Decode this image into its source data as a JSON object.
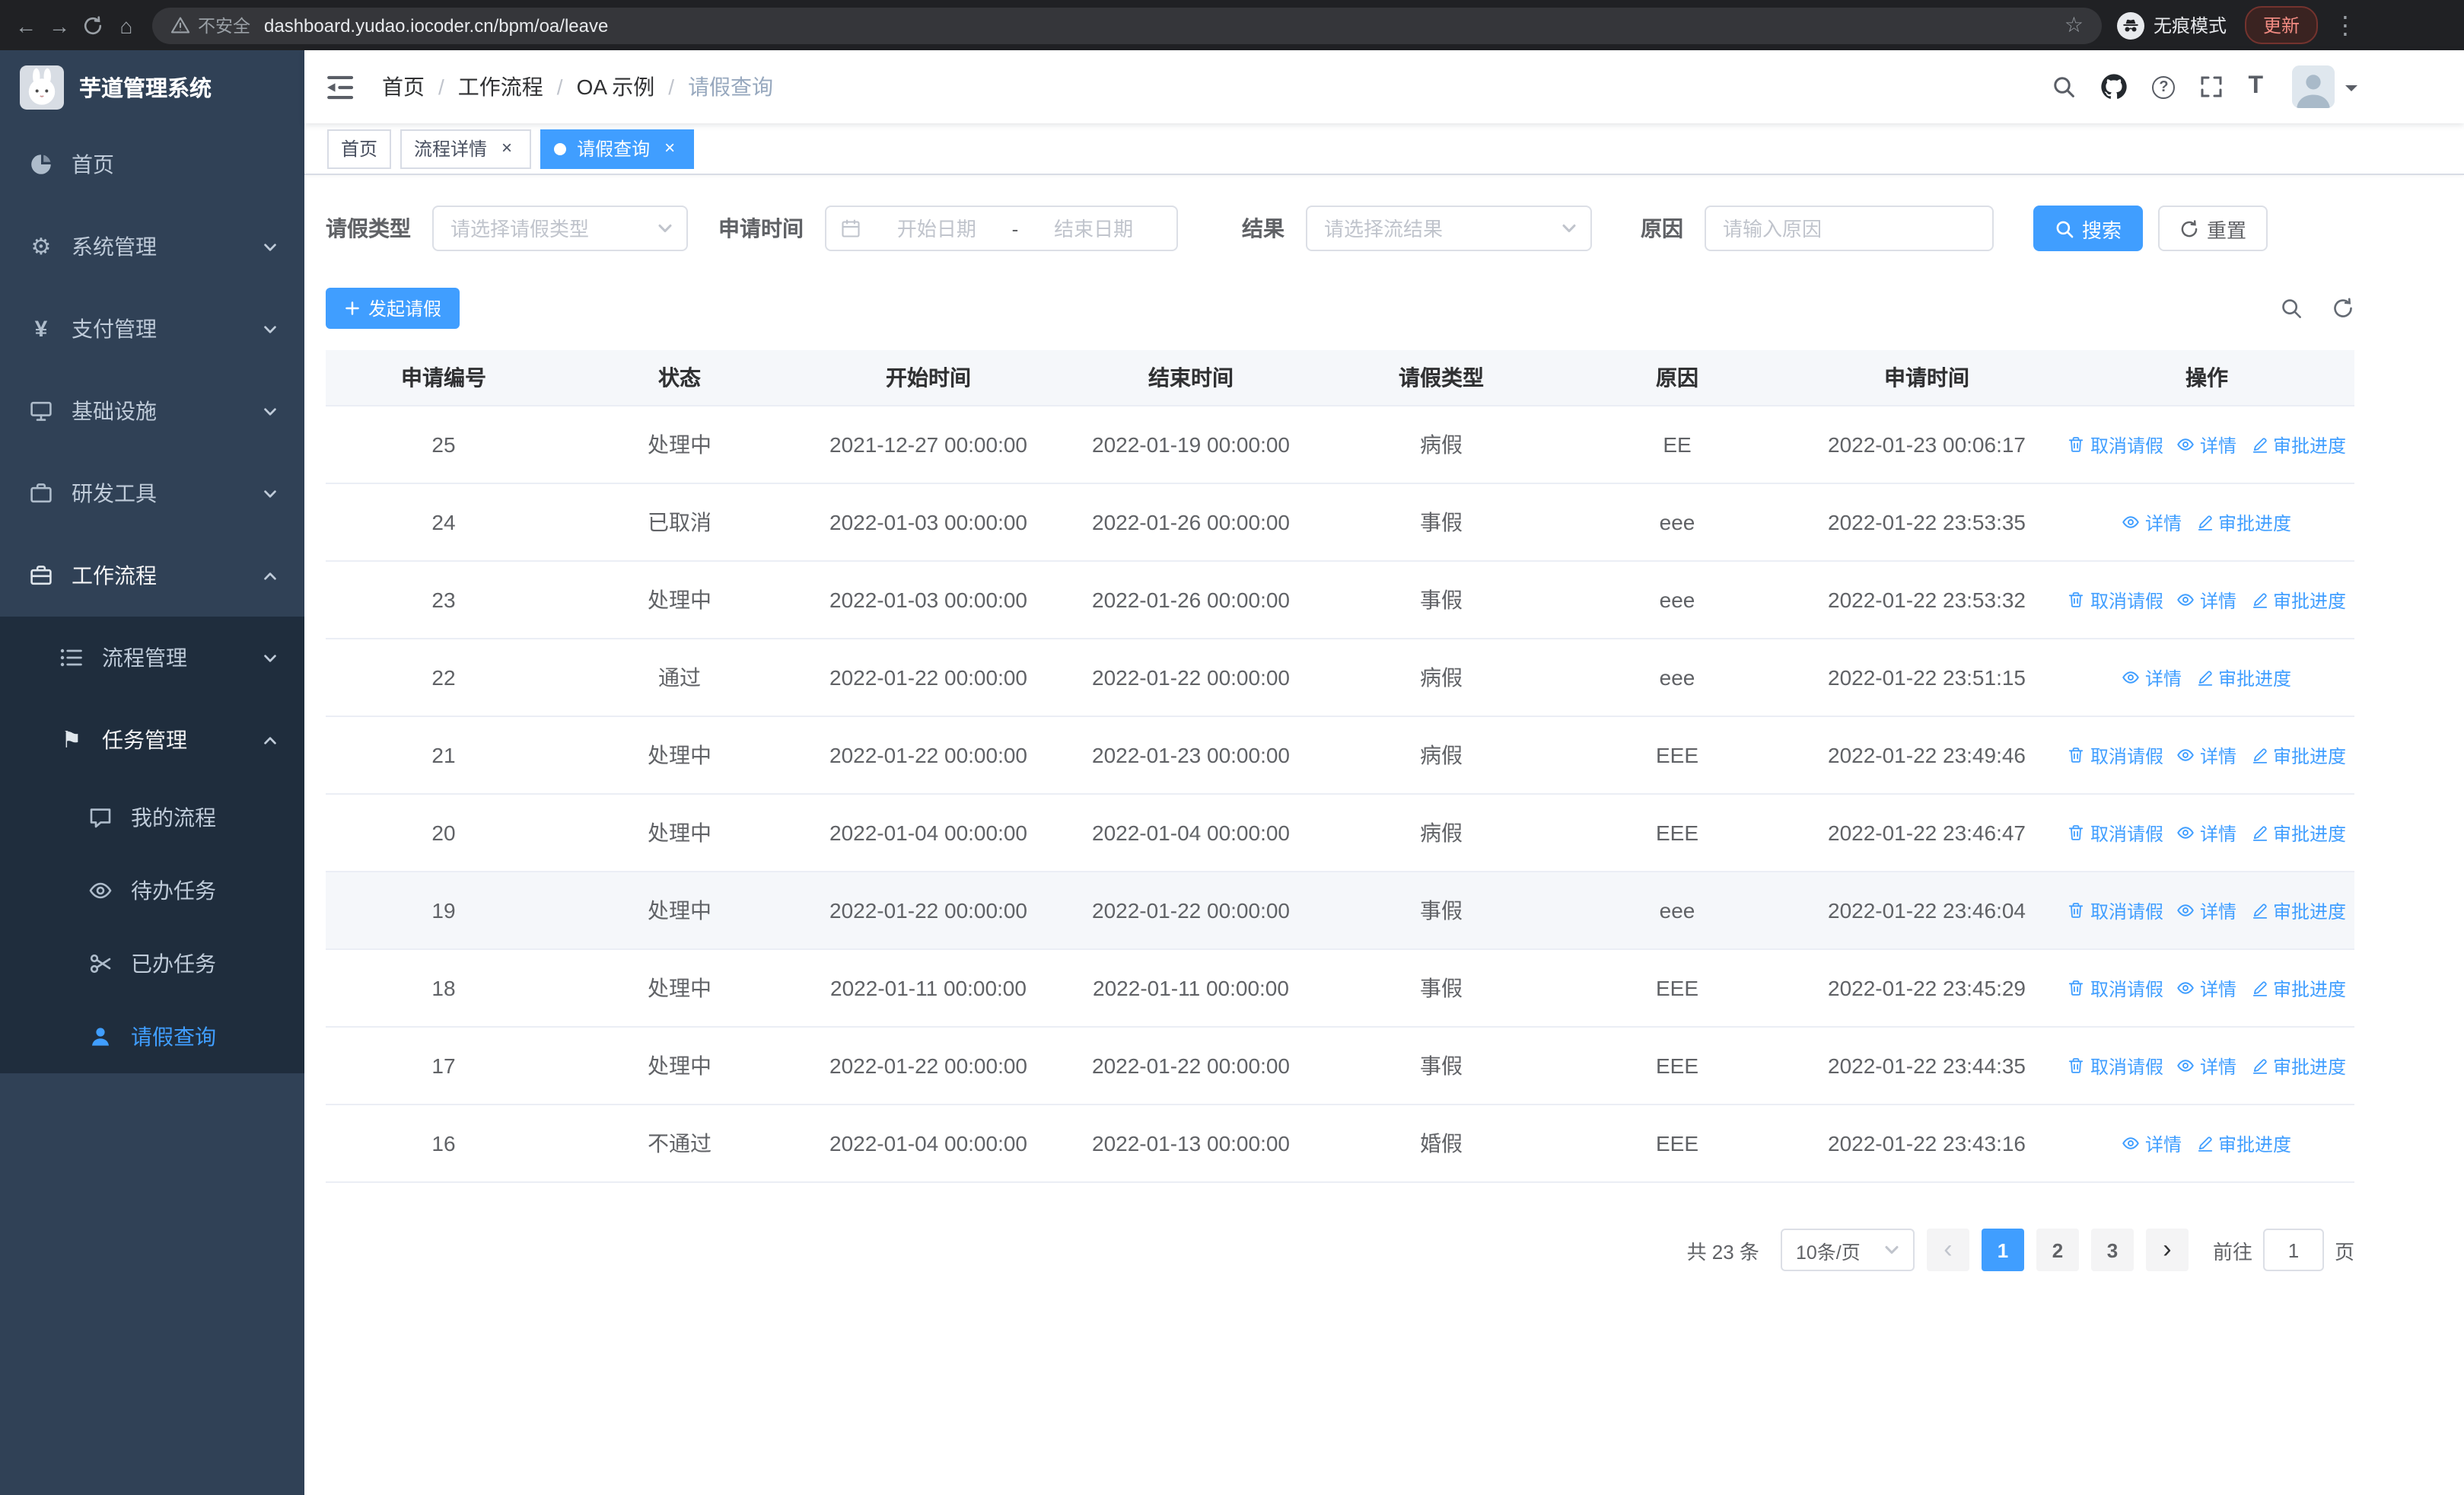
{
  "browser": {
    "security_label": "不安全",
    "url": "dashboard.yudao.iocoder.cn/bpm/oa/leave",
    "incognito_label": "无痕模式",
    "update_label": "更新"
  },
  "sidebar": {
    "logo_title": "芋道管理系统",
    "menu": [
      {
        "id": "home",
        "label": "首页",
        "icon": "dashboard"
      },
      {
        "id": "system",
        "label": "系统管理",
        "icon": "gear",
        "arrow": "down"
      },
      {
        "id": "payment",
        "label": "支付管理",
        "icon": "yen",
        "arrow": "down"
      },
      {
        "id": "infra",
        "label": "基础设施",
        "icon": "monitor",
        "arrow": "down"
      },
      {
        "id": "devtools",
        "label": "研发工具",
        "icon": "tool",
        "arrow": "down"
      },
      {
        "id": "workflow",
        "label": "工作流程",
        "icon": "suitcase",
        "arrow": "up",
        "open": true
      }
    ],
    "workflow_children": [
      {
        "id": "process-mgmt",
        "label": "流程管理",
        "icon": "list",
        "arrow": "down"
      },
      {
        "id": "task-mgmt",
        "label": "任务管理",
        "icon": "flag",
        "arrow": "up",
        "open": true
      }
    ],
    "task_children": [
      {
        "id": "my-process",
        "label": "我的流程",
        "icon": "chat"
      },
      {
        "id": "todo-task",
        "label": "待办任务",
        "icon": "eye"
      },
      {
        "id": "done-task",
        "label": "已办任务",
        "icon": "scissors"
      },
      {
        "id": "leave-query",
        "label": "请假查询",
        "icon": "user",
        "active": true
      }
    ]
  },
  "header": {
    "breadcrumb": [
      "首页",
      "工作流程",
      "OA 示例",
      "请假查询"
    ]
  },
  "tags": [
    {
      "id": "home",
      "label": "首页",
      "closable": false,
      "active": false
    },
    {
      "id": "process-detail",
      "label": "流程详情",
      "closable": true,
      "active": false
    },
    {
      "id": "leave-query",
      "label": "请假查询",
      "closable": true,
      "active": true
    }
  ],
  "filters": {
    "leave_type_label": "请假类型",
    "leave_type_placeholder": "请选择请假类型",
    "apply_time_label": "申请时间",
    "date_start_placeholder": "开始日期",
    "date_separator": "-",
    "date_end_placeholder": "结束日期",
    "result_label": "结果",
    "result_placeholder": "请选择流结果",
    "reason_label": "原因",
    "reason_placeholder": "请输入原因",
    "search_label": "搜索",
    "reset_label": "重置"
  },
  "toolbar": {
    "create_label": "发起请假"
  },
  "table": {
    "columns": [
      "申请编号",
      "状态",
      "开始时间",
      "结束时间",
      "请假类型",
      "原因",
      "申请时间",
      "操作"
    ],
    "action_labels": {
      "cancel": "取消请假",
      "detail": "详情",
      "progress": "审批进度"
    },
    "rows": [
      {
        "id": "25",
        "status": "处理中",
        "start": "2021-12-27 00:00:00",
        "end": "2022-01-19 00:00:00",
        "type": "病假",
        "reason": "EE",
        "apply_time": "2022-01-23 00:06:17",
        "can_cancel": true
      },
      {
        "id": "24",
        "status": "已取消",
        "start": "2022-01-03 00:00:00",
        "end": "2022-01-26 00:00:00",
        "type": "事假",
        "reason": "eee",
        "apply_time": "2022-01-22 23:53:35",
        "can_cancel": false
      },
      {
        "id": "23",
        "status": "处理中",
        "start": "2022-01-03 00:00:00",
        "end": "2022-01-26 00:00:00",
        "type": "事假",
        "reason": "eee",
        "apply_time": "2022-01-22 23:53:32",
        "can_cancel": true
      },
      {
        "id": "22",
        "status": "通过",
        "start": "2022-01-22 00:00:00",
        "end": "2022-01-22 00:00:00",
        "type": "病假",
        "reason": "eee",
        "apply_time": "2022-01-22 23:51:15",
        "can_cancel": false
      },
      {
        "id": "21",
        "status": "处理中",
        "start": "2022-01-22 00:00:00",
        "end": "2022-01-23 00:00:00",
        "type": "病假",
        "reason": "EEE",
        "apply_time": "2022-01-22 23:49:46",
        "can_cancel": true
      },
      {
        "id": "20",
        "status": "处理中",
        "start": "2022-01-04 00:00:00",
        "end": "2022-01-04 00:00:00",
        "type": "病假",
        "reason": "EEE",
        "apply_time": "2022-01-22 23:46:47",
        "can_cancel": true
      },
      {
        "id": "19",
        "status": "处理中",
        "start": "2022-01-22 00:00:00",
        "end": "2022-01-22 00:00:00",
        "type": "事假",
        "reason": "eee",
        "apply_time": "2022-01-22 23:46:04",
        "can_cancel": true,
        "highlight": true
      },
      {
        "id": "18",
        "status": "处理中",
        "start": "2022-01-11 00:00:00",
        "end": "2022-01-11 00:00:00",
        "type": "事假",
        "reason": "EEE",
        "apply_time": "2022-01-22 23:45:29",
        "can_cancel": true
      },
      {
        "id": "17",
        "status": "处理中",
        "start": "2022-01-22 00:00:00",
        "end": "2022-01-22 00:00:00",
        "type": "事假",
        "reason": "EEE",
        "apply_time": "2022-01-22 23:44:35",
        "can_cancel": true
      },
      {
        "id": "16",
        "status": "不通过",
        "start": "2022-01-04 00:00:00",
        "end": "2022-01-13 00:00:00",
        "type": "婚假",
        "reason": "EEE",
        "apply_time": "2022-01-22 23:43:16",
        "can_cancel": false
      }
    ]
  },
  "pagination": {
    "total": "共 23 条",
    "page_size": "10条/页",
    "pages": [
      "1",
      "2",
      "3"
    ],
    "active_page": "1",
    "goto_prefix": "前往",
    "goto_value": "1",
    "goto_suffix": "页"
  }
}
